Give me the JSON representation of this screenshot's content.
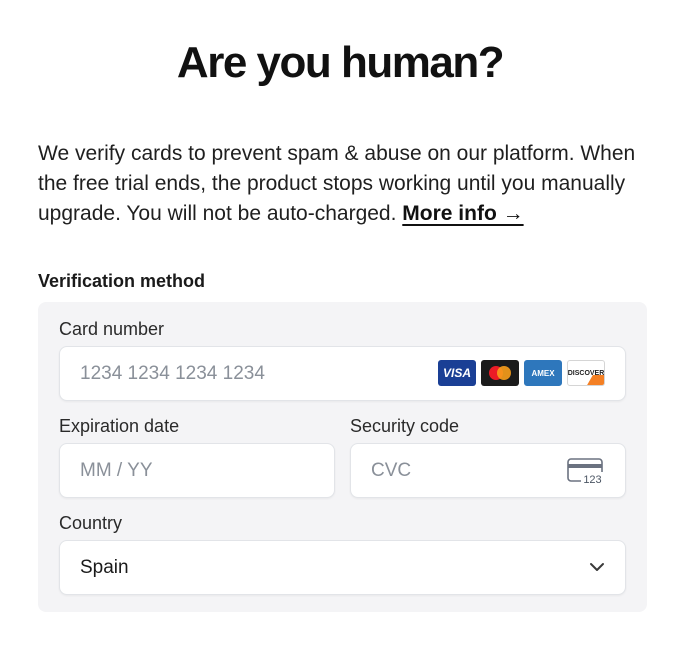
{
  "heading": "Are you human?",
  "intro": {
    "text": "We verify cards to prevent spam & abuse on our platform. When the free trial ends, the product stops working until you manually upgrade. You will not be auto-charged. ",
    "link": "More info →"
  },
  "verification": {
    "label": "Verification method",
    "card_number": {
      "label": "Card number",
      "placeholder": "1234 1234 1234 1234"
    },
    "brands": [
      "VISA",
      "mastercard",
      "AMEX",
      "DISCOVER"
    ],
    "expiration": {
      "label": "Expiration date",
      "placeholder": "MM / YY"
    },
    "security": {
      "label": "Security code",
      "placeholder": "CVC",
      "icon_text": "123"
    },
    "country": {
      "label": "Country",
      "value": "Spain"
    }
  },
  "colors": {
    "panel_bg": "#f4f4f6",
    "visa": "#1a3f95",
    "amex": "#2e77bc",
    "mastercard_red": "#eb1c26",
    "mastercard_orange": "#f99f1b",
    "discover_orange": "#f48024"
  },
  "icons": [
    "visa-icon",
    "mastercard-icon",
    "amex-icon",
    "discover-icon",
    "cvc-card-icon",
    "chevron-down-icon"
  ]
}
